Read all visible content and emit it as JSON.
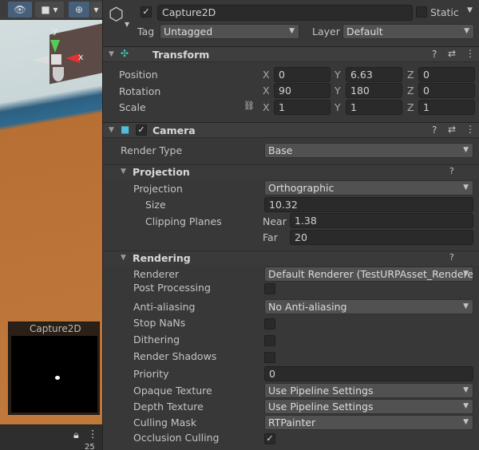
{
  "scene": {
    "preview_title": "Capture2D",
    "status_count": "25",
    "axis_x": "x",
    "axis_y": "y"
  },
  "header": {
    "name": "Capture2D",
    "active": true,
    "static_label": "Static",
    "static": false,
    "tag_label": "Tag",
    "tag_value": "Untagged",
    "layer_label": "Layer",
    "layer_value": "Default"
  },
  "transform": {
    "title": "Transform",
    "rows": [
      {
        "label": "Position",
        "x": "0",
        "y": "6.63",
        "z": "0"
      },
      {
        "label": "Rotation",
        "x": "90",
        "y": "180",
        "z": "0"
      },
      {
        "label": "Scale",
        "x": "1",
        "y": "1",
        "z": "1"
      }
    ],
    "axis": {
      "x": "X",
      "y": "Y",
      "z": "Z"
    }
  },
  "camera": {
    "title": "Camera",
    "enabled": true,
    "render_type_label": "Render Type",
    "render_type": "Base",
    "projection": {
      "title": "Projection",
      "projection_label": "Projection",
      "projection_value": "Orthographic",
      "size_label": "Size",
      "size_value": "10.32",
      "clipping_label": "Clipping Planes",
      "near_label": "Near",
      "near_value": "1.38",
      "far_label": "Far",
      "far_value": "20"
    },
    "rendering": {
      "title": "Rendering",
      "renderer_label": "Renderer",
      "renderer_value": "Default Renderer (TestURPAsset_Renderer)",
      "post_processing_label": "Post Processing",
      "anti_aliasing_label": "Anti-aliasing",
      "anti_aliasing_value": "No Anti-aliasing",
      "stop_nans_label": "Stop NaNs",
      "dithering_label": "Dithering",
      "render_shadows_label": "Render Shadows",
      "priority_label": "Priority",
      "priority_value": "0",
      "opaque_texture_label": "Opaque Texture",
      "opaque_texture_value": "Use Pipeline Settings",
      "depth_texture_label": "Depth Texture",
      "depth_texture_value": "Use Pipeline Settings",
      "culling_mask_label": "Culling Mask",
      "culling_mask_value": "RTPainter",
      "occlusion_culling_label": "Occlusion Culling"
    }
  }
}
